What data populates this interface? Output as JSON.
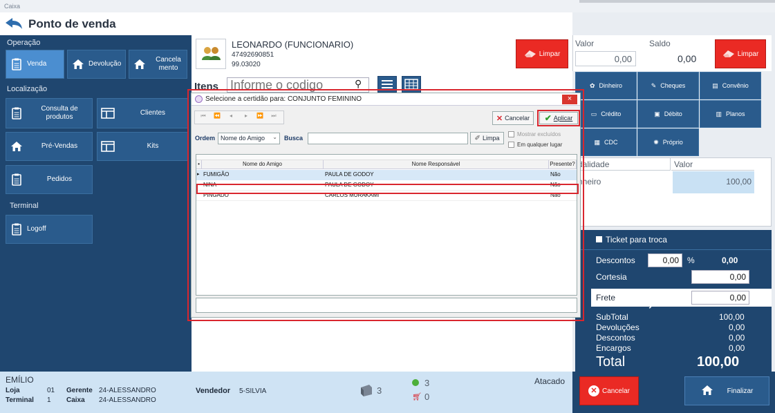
{
  "window": {
    "title": "Caixa"
  },
  "header": {
    "title": "Ponto de venda"
  },
  "left": {
    "section_operacao": "Operação",
    "btn_venda": "Venda",
    "btn_devolucao": "Devolução",
    "btn_cancelamento": "Cancela mento",
    "section_localizacao": "Localização",
    "btn_consulta": "Consulta de produtos",
    "btn_clientes": "Clientes",
    "btn_prevendas": "Pré-Vendas",
    "btn_kits": "Kits",
    "btn_pedidos": "Pedidos",
    "section_terminal": "Terminal",
    "btn_logoff": "Logoff"
  },
  "footer_left": {
    "user": "EMÍLIO",
    "loja_label": "Loja",
    "loja_value": "01",
    "gerente_label": "Gerente",
    "gerente_value": "24-ALESSANDRO",
    "terminal_label": "Terminal",
    "terminal_value": "1",
    "caixa_label": "Caixa",
    "caixa_value": "24-ALESSANDRO"
  },
  "client": {
    "name": "LEONARDO (FUNCIONARIO)",
    "phone": "47492690851",
    "code": "99.03020",
    "limpar": "Limpar"
  },
  "items": {
    "label": "Itens",
    "placeholder": "Informe o codigo"
  },
  "footer_mid": {
    "vendedor_label": "Vendedor",
    "vendedor_value": "5-SILVIA",
    "items_count": "3",
    "ok_count": "3",
    "cart_count": "0",
    "atacado": "Atacado"
  },
  "right": {
    "valor_label": "Valor",
    "valor_value": "0,00",
    "saldo_label": "Saldo",
    "saldo_value": "0,00",
    "limpar": "Limpar",
    "pay": {
      "dinheiro": "Dinheiro",
      "cheques": "Cheques",
      "convenio": "Convênio",
      "credito": "Crédito",
      "debito": "Débito",
      "planos": "Planos",
      "cdc": "CDC",
      "proprio": "Próprio"
    },
    "table_head_modalidade": "dalidade",
    "table_head_valor": "Valor",
    "table_row_modalidade": "nheiro",
    "table_row_valor": "100,00"
  },
  "summary": {
    "ticket": "Ticket para troca",
    "descontos_label": "Descontos",
    "descontos_input": "0,00",
    "pct": "%",
    "descontos_total": "0,00",
    "cortesia_label": "Cortesia",
    "cortesia_value": "0,00",
    "frete_label": "Frete",
    "frete_value": "0,00",
    "subtotal_label": "SubTotal",
    "subtotal_value": "100,00",
    "devolucoes_label": "Devoluções",
    "devolucoes_value": "0,00",
    "descontos2_label": "Descontos",
    "descontos2_value": "0,00",
    "encargos_label": "Encargos",
    "encargos_value": "0,00",
    "total_label": "Total",
    "total_value": "100,00",
    "cancelar": "Cancelar",
    "finalizar": "Finalizar"
  },
  "dialog": {
    "title": "Selecione a certidão para: CONJUNTO FEMININO",
    "close": "×",
    "cancelar": "Cancelar",
    "aplicar": "Aplicar",
    "ordem_label": "Ordem",
    "ordem_value": "Nome do Amigo",
    "busca_label": "Busca",
    "busca_value": "",
    "limpa": "Limpa",
    "mostrar_excluidos": "Mostrar excluídos",
    "em_qualquer_lugar": "Em qualquer lugar",
    "columns": [
      "Nome do Amigo",
      "Nome Responsável",
      "Presente?"
    ],
    "rows": [
      [
        "FUMIGÃO",
        "PAULA DE GODOY",
        "Não"
      ],
      [
        "NINA",
        "PAULA DE GODOY",
        "Não"
      ],
      [
        "PINGADO",
        "CARLOS MURAKAMI",
        "Não"
      ]
    ]
  },
  "colors": {
    "navy": "#1f466f",
    "button_blue": "#2a5b8c",
    "active_blue": "#4b8ed0",
    "red": "#ea2a24",
    "highlight_red": "#d9262e"
  }
}
